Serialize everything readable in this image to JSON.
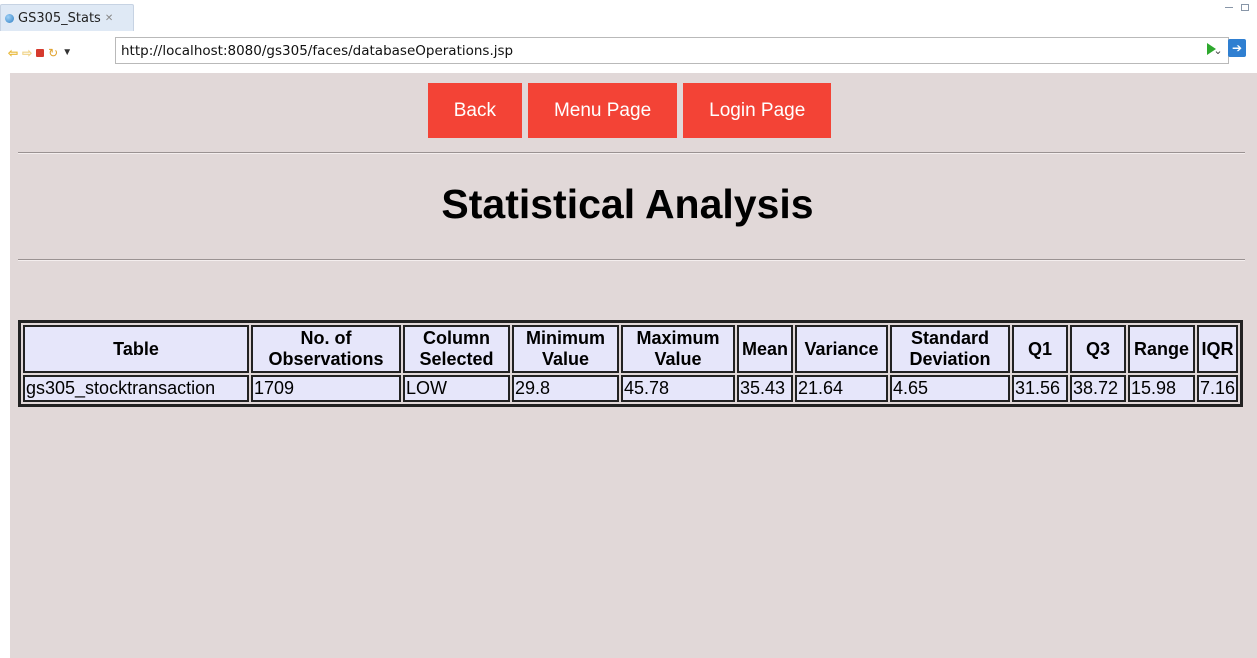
{
  "tab": {
    "title": "GS305_Stats",
    "close": "✕"
  },
  "navbar": {
    "url": "http://localhost:8080/gs305/faces/databaseOperations.jsp"
  },
  "buttons": {
    "back": "Back",
    "menu": "Menu Page",
    "login": "Login Page"
  },
  "page": {
    "title": "Statistical Analysis"
  },
  "table": {
    "headers": [
      "Table",
      "No. of Observations",
      "Column Selected",
      "Minimum Value",
      "Maximum Value",
      "Mean",
      "Variance",
      "Standard Deviation",
      "Q1",
      "Q3",
      "Range",
      "IQR"
    ],
    "rows": [
      [
        "gs305_stocktransaction",
        "1709",
        "LOW",
        "29.8",
        "45.78",
        "35.43",
        "21.64",
        "4.65",
        "31.56",
        "38.72",
        "15.98",
        "7.16"
      ]
    ]
  },
  "colors": {
    "button_bg": "#f34336",
    "page_bg": "#e1d8d8",
    "table_cell_bg": "#e6e6fa"
  },
  "icons": [
    "globe-icon",
    "close-icon",
    "back-arrow-icon",
    "forward-arrow-icon",
    "stop-icon",
    "refresh-icon",
    "dropdown-icon",
    "go-icon",
    "open-external-icon"
  ]
}
